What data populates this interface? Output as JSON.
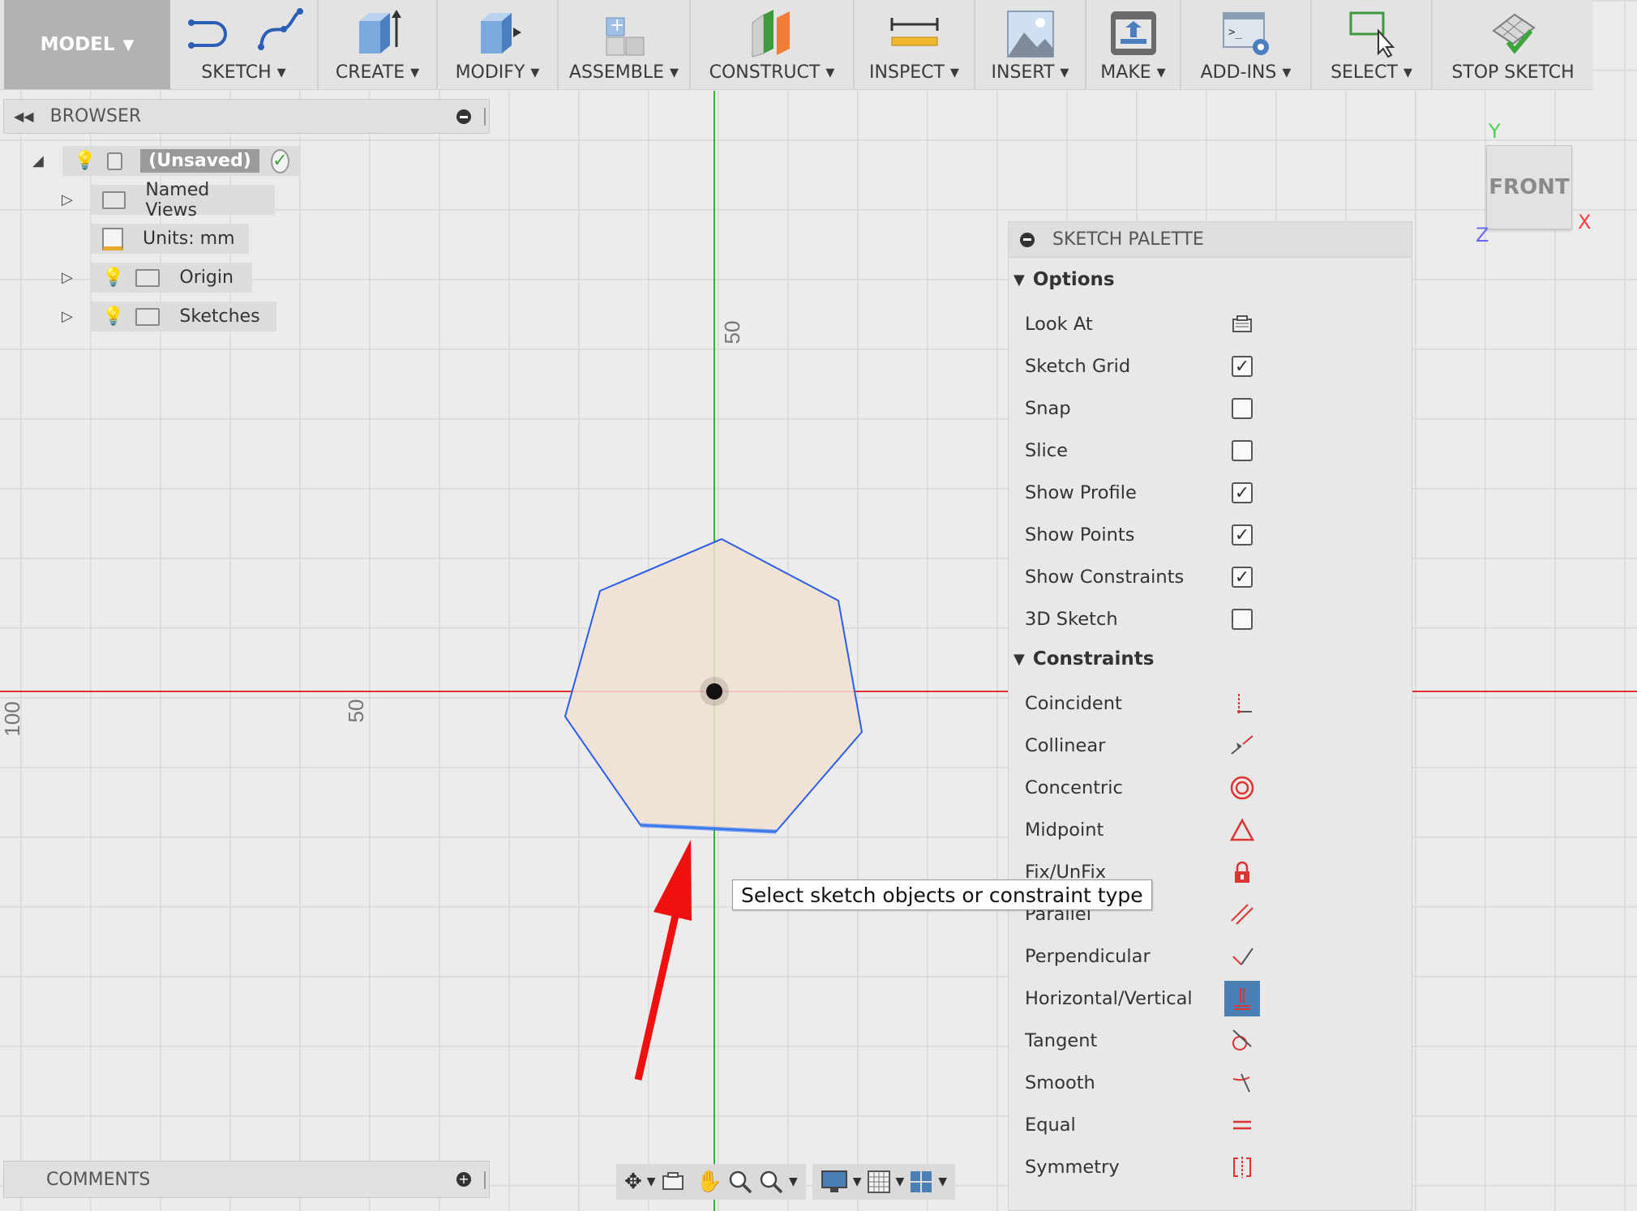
{
  "toolbar": {
    "mode": "MODEL",
    "groups": [
      {
        "label": "SKETCH"
      },
      {
        "label": "CREATE"
      },
      {
        "label": "MODIFY"
      },
      {
        "label": "ASSEMBLE"
      },
      {
        "label": "CONSTRUCT"
      },
      {
        "label": "INSPECT"
      },
      {
        "label": "INSERT"
      },
      {
        "label": "MAKE"
      },
      {
        "label": "ADD-INS"
      },
      {
        "label": "SELECT"
      },
      {
        "label": "STOP SKETCH"
      }
    ]
  },
  "browser": {
    "title": "BROWSER",
    "root": "(Unsaved)",
    "items": [
      {
        "label": "Named Views"
      },
      {
        "label": "Units: mm"
      },
      {
        "label": "Origin"
      },
      {
        "label": "Sketches"
      }
    ]
  },
  "canvas": {
    "label_y50": "50",
    "label_x50": "50",
    "label_x100": "100",
    "axis_x_color": "#e03030",
    "axis_y_color": "#2db52d",
    "profile_fill": "#f1e2d2",
    "profile_stroke": "#2a5ee8"
  },
  "viewcube": {
    "face": "FRONT",
    "axis_y": "Y",
    "axis_x": "X",
    "axis_z": "Z"
  },
  "palette": {
    "title": "SKETCH PALETTE",
    "options_header": "Options",
    "options": [
      {
        "label": "Look At",
        "control": "look-at-icon"
      },
      {
        "label": "Sketch Grid",
        "checked": true
      },
      {
        "label": "Snap",
        "checked": false
      },
      {
        "label": "Slice",
        "checked": false
      },
      {
        "label": "Show Profile",
        "checked": true
      },
      {
        "label": "Show Points",
        "checked": true
      },
      {
        "label": "Show Constraints",
        "checked": true
      },
      {
        "label": "3D Sketch",
        "checked": false
      }
    ],
    "constraints_header": "Constraints",
    "constraints": [
      {
        "label": "Coincident",
        "icon": "coincident-icon"
      },
      {
        "label": "Collinear",
        "icon": "collinear-icon"
      },
      {
        "label": "Concentric",
        "icon": "concentric-icon"
      },
      {
        "label": "Midpoint",
        "icon": "midpoint-icon"
      },
      {
        "label": "Fix/UnFix",
        "icon": "lock-icon"
      },
      {
        "label": "Parallel",
        "icon": "parallel-icon"
      },
      {
        "label": "Perpendicular",
        "icon": "perpendicular-icon"
      },
      {
        "label": "Horizontal/Vertical",
        "icon": "horizontal-vertical-icon",
        "active": true
      },
      {
        "label": "Tangent",
        "icon": "tangent-icon"
      },
      {
        "label": "Smooth",
        "icon": "smooth-icon"
      },
      {
        "label": "Equal",
        "icon": "equal-icon"
      },
      {
        "label": "Symmetry",
        "icon": "symmetry-icon"
      }
    ]
  },
  "tooltip": {
    "text": "Select sketch objects or constraint type"
  },
  "comments": {
    "title": "COMMENTS"
  },
  "colors": {
    "accent_arrow": "#f01010",
    "active_constraint": "#4a7fb5"
  }
}
